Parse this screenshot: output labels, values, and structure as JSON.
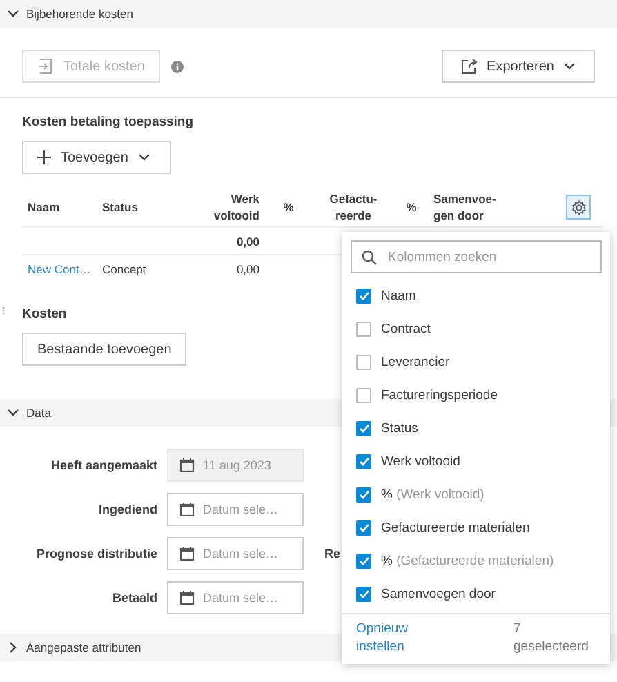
{
  "sections": [
    {
      "title": "Bijbehorende kosten",
      "expanded": true
    },
    {
      "title": "Data",
      "expanded": true
    },
    {
      "title": "Aangepaste attributen",
      "expanded": false
    }
  ],
  "toolbar": {
    "total_button": {
      "label": "Totale kosten",
      "disabled": true
    },
    "export_button": {
      "label": "Exporteren"
    }
  },
  "payments": {
    "title": "Kosten betaling toepassing",
    "add_button": "Toevoegen",
    "columns": [
      "Naam",
      "Status",
      "Werk voltooid",
      "%",
      "Gefactu- reerde",
      "%",
      "Samenvoe- gen door"
    ],
    "total_work_done": "0,00",
    "rows": [
      {
        "name": "New Cont…",
        "status": "Concept",
        "work_done": "0,00"
      }
    ],
    "settings_active": true
  },
  "costs": {
    "title": "Kosten",
    "button": "Bestaande toevoegen"
  },
  "form": [
    {
      "label": "Heeft aangemaakt",
      "value": "11 aug 2023",
      "disabled": true
    },
    {
      "label": "Ingediend",
      "placeholder": "Datum sele…",
      "disabled": false
    },
    {
      "label": "Prognose distributie",
      "placeholder": "Datum sele…",
      "disabled": false,
      "side_label": "Re"
    },
    {
      "label": "Betaald",
      "placeholder": "Datum sele…",
      "disabled": false
    }
  ],
  "column_menu": {
    "search_placeholder": "Kolommen zoeken",
    "items": [
      {
        "label": "Naam",
        "checked": true
      },
      {
        "label": "Contract",
        "checked": false
      },
      {
        "label": "Leverancier",
        "checked": false
      },
      {
        "label": "Factureringsperiode",
        "checked": false
      },
      {
        "label": "Status",
        "checked": true
      },
      {
        "label": "Werk voltooid",
        "checked": true
      },
      {
        "label": "%",
        "note": "(Werk voltooid)",
        "checked": true
      },
      {
        "label": "Gefactureerde materialen",
        "checked": true
      },
      {
        "label": "%",
        "note": "(Gefactureerde materialen)",
        "checked": true
      },
      {
        "label": "Samenvoegen door",
        "checked": true
      }
    ],
    "reset_link": "Opnieuw instellen",
    "selected_count": "7 geselecteerd"
  }
}
